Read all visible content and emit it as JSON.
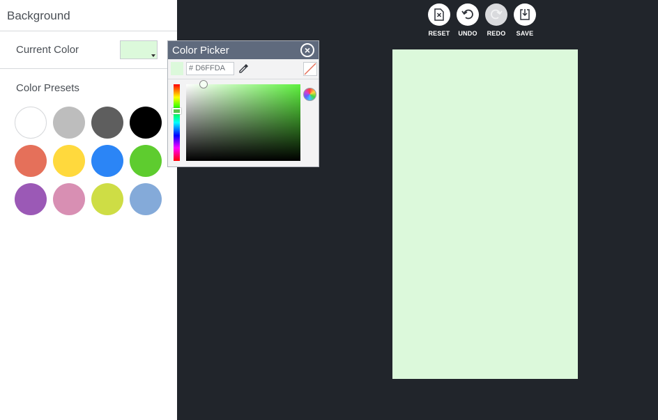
{
  "panel": {
    "title": "Background",
    "current_color_label": "Current Color",
    "current_color": "#DCF9DB",
    "presets_label": "Color Presets",
    "presets": [
      {
        "name": "white",
        "color": "#FFFFFF"
      },
      {
        "name": "light-gray",
        "color": "#BDBDBD"
      },
      {
        "name": "dark-gray",
        "color": "#5E5E5E"
      },
      {
        "name": "black",
        "color": "#000000"
      },
      {
        "name": "coral",
        "color": "#E5705A"
      },
      {
        "name": "yellow",
        "color": "#FFD93D"
      },
      {
        "name": "blue",
        "color": "#2B85F6"
      },
      {
        "name": "green",
        "color": "#5ECC2F"
      },
      {
        "name": "purple",
        "color": "#9B59B6"
      },
      {
        "name": "pink",
        "color": "#D88FB3"
      },
      {
        "name": "lime",
        "color": "#CEDD45"
      },
      {
        "name": "sky-blue",
        "color": "#84AAD9"
      }
    ]
  },
  "toolbar": {
    "reset_label": "RESET",
    "undo_label": "UNDO",
    "redo_label": "REDO",
    "save_label": "SAVE"
  },
  "picker": {
    "title": "Color Picker",
    "hash": "#",
    "hex_value": "D6FFDA",
    "preview_color": "#DCF9DB"
  },
  "canvas": {
    "background": "#DCF9DB"
  },
  "colors": {
    "workspace_bg": "#21252B",
    "picker_header": "#5F6A7D"
  }
}
